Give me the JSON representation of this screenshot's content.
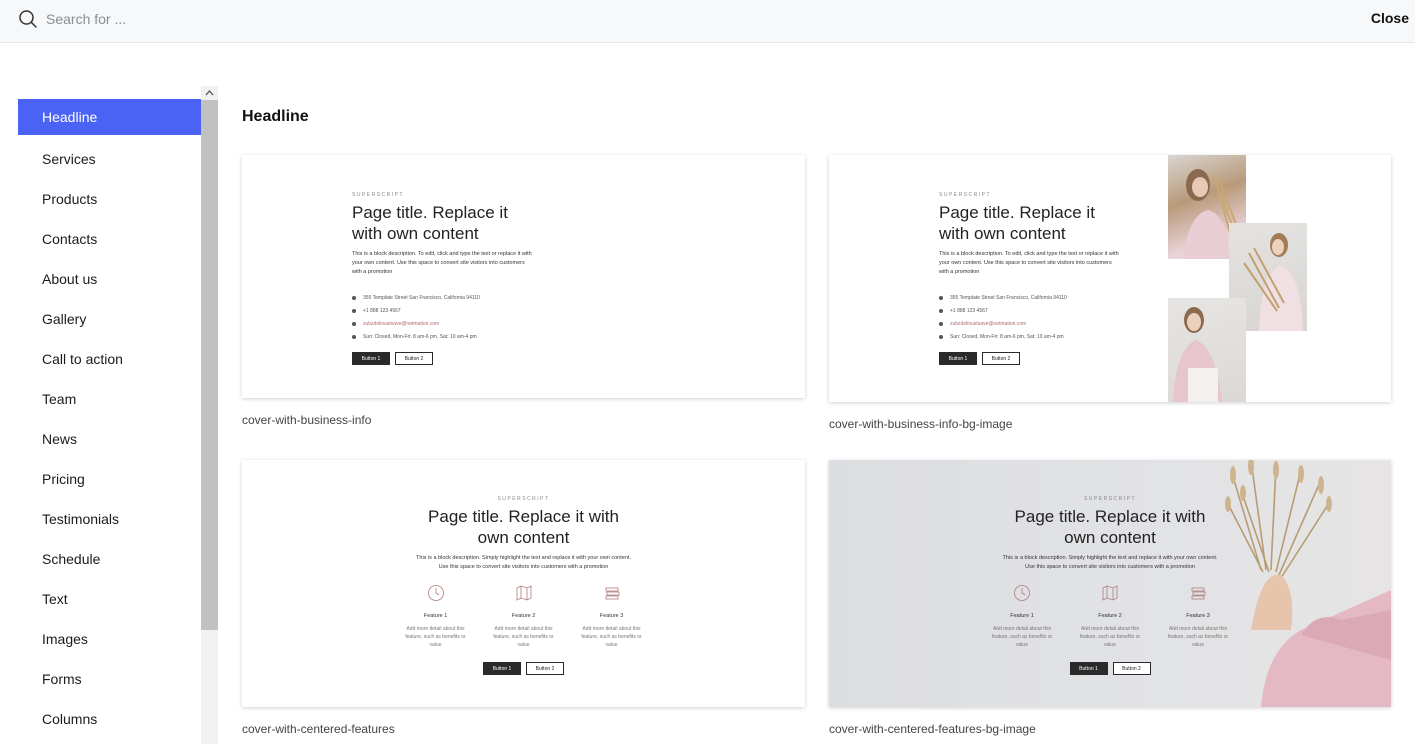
{
  "search": {
    "placeholder": "Search for ..."
  },
  "header": {
    "close_label": "Close"
  },
  "sidebar": {
    "items": [
      {
        "label": "Headline",
        "active": true
      },
      {
        "label": "Services"
      },
      {
        "label": "Products"
      },
      {
        "label": "Contacts"
      },
      {
        "label": "About us"
      },
      {
        "label": "Gallery"
      },
      {
        "label": "Call to action"
      },
      {
        "label": "Team"
      },
      {
        "label": "News"
      },
      {
        "label": "Pricing"
      },
      {
        "label": "Testimonials"
      },
      {
        "label": "Schedule"
      },
      {
        "label": "Text"
      },
      {
        "label": "Images"
      },
      {
        "label": "Forms"
      },
      {
        "label": "Columns"
      }
    ]
  },
  "main": {
    "section_title": "Headline",
    "cards": [
      {
        "caption": "cover-with-business-info",
        "superscript": "SUPERSCRIPT",
        "title": "Page title. Replace it with own content",
        "description": "This is a block description. To edit, click and type the text or replace it with your own content. Use this space to convert site visitors into customers with a promotion",
        "address": "355 Template Street San Francisco, California 94110",
        "phone": "+1 888 123 4567",
        "email": "zubzdelinustsave@netmation.com",
        "hours": "Sun: Closed, Mon-Fri: 8 am-6 pm, Sat: 10 am-4 pm",
        "button1": "Button 1",
        "button2": "Button 2"
      },
      {
        "caption": "cover-with-business-info-bg-image",
        "superscript": "SUPERSCRIPT",
        "title": "Page title. Replace it with own content",
        "description": "This is a block description. To edit, click and type the text or replace it with your own content. Use this space to convert site visitors into customers with a promotion",
        "address": "355 Template Street San Francisco, California 94110",
        "phone": "+1 888 123 4567",
        "email": "zubzdelinustsave@netmation.com",
        "hours": "Sun: Closed, Mon-Fri: 8 am-6 pm, Sat: 10 am-4 pm",
        "button1": "Button 1",
        "button2": "Button 2"
      },
      {
        "caption": "cover-with-centered-features",
        "superscript": "SUPERSCRIPT",
        "title": "Page title. Replace it with own content",
        "description": "This is a block description. Simply highlight the text and replace it with your own content. Use this space to convert site visitors into customers with a promotion",
        "features": [
          {
            "name": "Feature 1",
            "desc": "Add more detail about this feature, such as benefits or value"
          },
          {
            "name": "Feature 2",
            "desc": "Add more detail about this feature, such as benefits or value"
          },
          {
            "name": "Feature 3",
            "desc": "Add more detail about this feature, such as benefits or value"
          }
        ],
        "button1": "Button 1",
        "button2": "Button 2"
      },
      {
        "caption": "cover-with-centered-features-bg-image",
        "superscript": "SUPERSCRIPT",
        "title": "Page title. Replace it with own content",
        "description": "This is a block description. Simply highlight the text and replace it with your own content. Use this space to convert site visitors into customers with a promotion",
        "features": [
          {
            "name": "Feature 1",
            "desc": "Add more detail about this feature, such as benefits or value"
          },
          {
            "name": "Feature 2",
            "desc": "Add more detail about this feature, such as benefits or value"
          },
          {
            "name": "Feature 3",
            "desc": "Add more detail about this feature, such as benefits or value"
          }
        ],
        "button1": "Button 1",
        "button2": "Button 2"
      }
    ]
  },
  "colors": {
    "accent": "#4a63f5",
    "dark_button": "#2a2a2a",
    "link": "#b06a6a"
  }
}
